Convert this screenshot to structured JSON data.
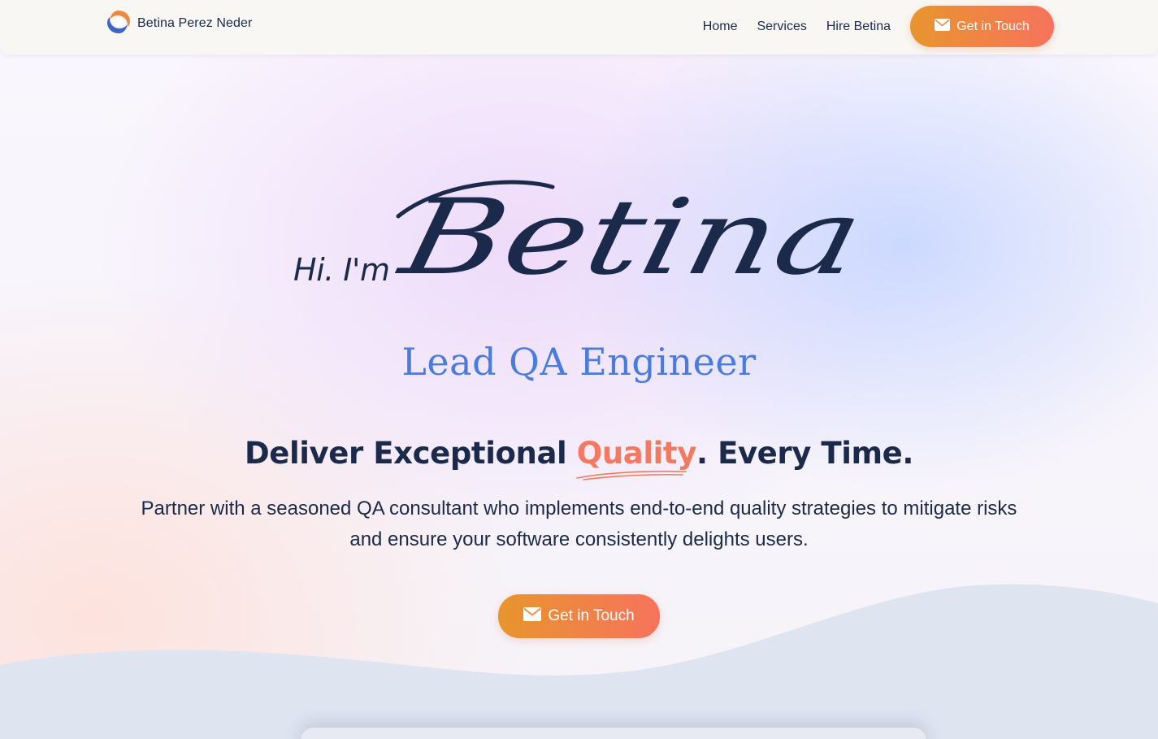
{
  "header": {
    "brand_name": "Betina Perez Neder",
    "logo_icon": "logo-swirl-icon",
    "nav": [
      {
        "label": "Home"
      },
      {
        "label": "Services"
      },
      {
        "label": "Hire Betina"
      }
    ],
    "cta_label": "Get in Touch",
    "cta_icon": "envelope-icon"
  },
  "hero": {
    "greeting": "Hi. I'm",
    "name_script": "Betina",
    "role": "Lead QA Engineer",
    "tagline_pre": "Deliver Exceptional ",
    "tagline_highlight": "Quality",
    "tagline_post": ". Every Time.",
    "intro": "Partner with a seasoned QA consultant who implements end-to-end quality strategies to mitigate risks and ensure your software consistently delights users.",
    "cta_label": "Get in Touch"
  },
  "colors": {
    "navy": "#1b2a4a",
    "role_blue": "#4a7ce0",
    "accent_coral": "#f37a60",
    "cta_orange": "#e8952e",
    "wave": "#dfe4f1"
  }
}
